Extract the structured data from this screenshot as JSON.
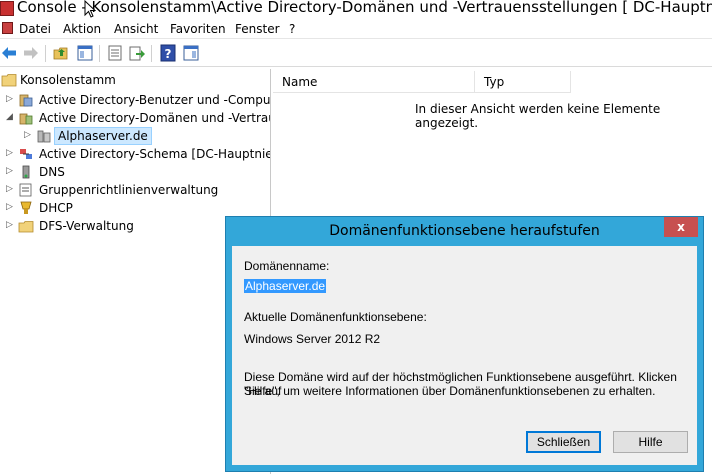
{
  "window": {
    "title": "Console - Konsolenstamm\\Active Directory-Domänen und -Vertrauensstellungen [ DC-Hauptniederlassung"
  },
  "menu": [
    "Datei",
    "Aktion",
    "Ansicht",
    "Favoriten",
    "Fenster",
    "?"
  ],
  "toolbar": {
    "icons": [
      "back-arrow-icon",
      "forward-arrow-icon",
      "up-folder-icon",
      "show-hide-tree-icon",
      "properties-icon",
      "export-list-icon",
      "help-icon",
      "show-hide-action-pane-icon"
    ]
  },
  "tree": {
    "root": "Konsolenstamm",
    "items": [
      {
        "label": "Active Directory-Benutzer und -Computer [",
        "expander": "▷"
      },
      {
        "label": "Active Directory-Domänen und -Vertrauens",
        "expander": "◢"
      },
      {
        "label": "Alphaserver.de",
        "expander": "▷"
      },
      {
        "label": "Active Directory-Schema [DC-Hauptniederl",
        "expander": "▷"
      },
      {
        "label": "DNS",
        "expander": "▷"
      },
      {
        "label": "Gruppenrichtlinienverwaltung",
        "expander": "▷"
      },
      {
        "label": "DHCP",
        "expander": "▷"
      },
      {
        "label": "DFS-Verwaltung",
        "expander": "▷"
      }
    ]
  },
  "list": {
    "columns": [
      "Name",
      "Typ"
    ],
    "empty_message": "In dieser Ansicht werden keine Elemente angezeigt."
  },
  "dialog": {
    "title": "Domänenfunktionsebene heraufstufen",
    "close_label": "x",
    "domain_name_label": "Domänenname:",
    "domain_name_value": "Alphaserver.de",
    "current_level_label": "Aktuelle Domänenfunktionsebene:",
    "current_level_value": "Windows Server 2012 R2",
    "info_line1": "Diese Domäne wird auf der höchstmöglichen Funktionsebene ausgeführt. Klicken Sie auf",
    "info_line2": "\"Hilfe\", um weitere Informationen über Domänenfunktionsebenen zu erhalten.",
    "close_button": "Schließen",
    "help_button": "Hilfe"
  }
}
